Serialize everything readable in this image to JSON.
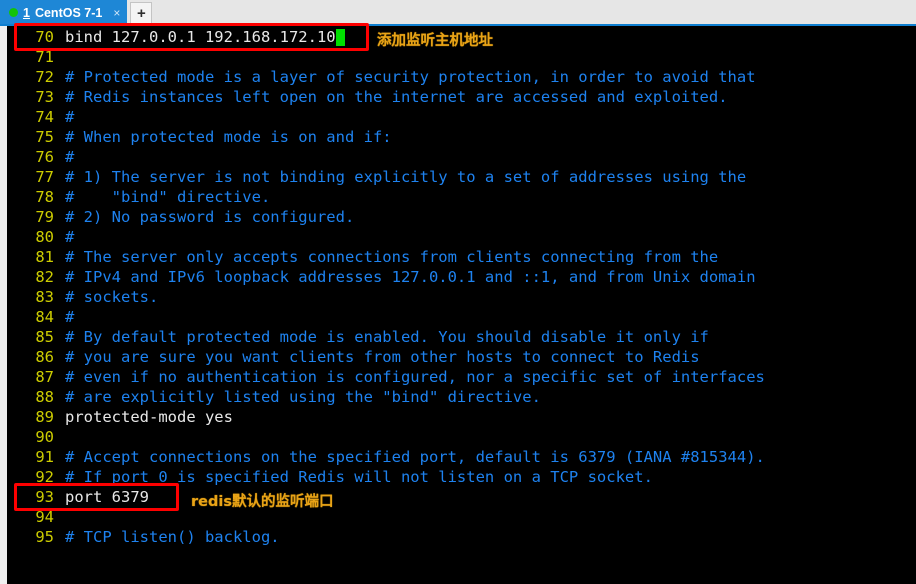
{
  "window": {
    "title": "CentOS 7-1",
    "accent_blue": "#1e87d6",
    "terminal_bg": "#000000",
    "annotation_color": "#e8a317",
    "highlight_color": "#fe0000"
  },
  "tabbar": {
    "tabs": [
      {
        "index": "1",
        "label": "CentOS 7-1",
        "status_dot": "green-dot-icon",
        "close_label": "×",
        "active": true
      }
    ],
    "new_tab_label": "+"
  },
  "terminal": {
    "app": "vim",
    "file_context": "redis.conf",
    "lines": [
      {
        "num": "70",
        "text": "bind 127.0.0.1 192.168.172.10",
        "type": "code",
        "cursor": true
      },
      {
        "num": "71",
        "text": "",
        "type": "code",
        "cursor": false
      },
      {
        "num": "72",
        "text": "# Protected mode is a layer of security protection, in order to avoid that",
        "type": "comment",
        "cursor": false
      },
      {
        "num": "73",
        "text": "# Redis instances left open on the internet are accessed and exploited.",
        "type": "comment",
        "cursor": false
      },
      {
        "num": "74",
        "text": "#",
        "type": "comment",
        "cursor": false
      },
      {
        "num": "75",
        "text": "# When protected mode is on and if:",
        "type": "comment",
        "cursor": false
      },
      {
        "num": "76",
        "text": "#",
        "type": "comment",
        "cursor": false
      },
      {
        "num": "77",
        "text": "# 1) The server is not binding explicitly to a set of addresses using the",
        "type": "comment",
        "cursor": false
      },
      {
        "num": "78",
        "text": "#    \"bind\" directive.",
        "type": "comment",
        "cursor": false
      },
      {
        "num": "79",
        "text": "# 2) No password is configured.",
        "type": "comment",
        "cursor": false
      },
      {
        "num": "80",
        "text": "#",
        "type": "comment",
        "cursor": false
      },
      {
        "num": "81",
        "text": "# The server only accepts connections from clients connecting from the",
        "type": "comment",
        "cursor": false
      },
      {
        "num": "82",
        "text": "# IPv4 and IPv6 loopback addresses 127.0.0.1 and ::1, and from Unix domain",
        "type": "comment",
        "cursor": false
      },
      {
        "num": "83",
        "text": "# sockets.",
        "type": "comment",
        "cursor": false
      },
      {
        "num": "84",
        "text": "#",
        "type": "comment",
        "cursor": false
      },
      {
        "num": "85",
        "text": "# By default protected mode is enabled. You should disable it only if",
        "type": "comment",
        "cursor": false
      },
      {
        "num": "86",
        "text": "# you are sure you want clients from other hosts to connect to Redis",
        "type": "comment",
        "cursor": false
      },
      {
        "num": "87",
        "text": "# even if no authentication is configured, nor a specific set of interfaces",
        "type": "comment",
        "cursor": false
      },
      {
        "num": "88",
        "text": "# are explicitly listed using the \"bind\" directive.",
        "type": "comment",
        "cursor": false
      },
      {
        "num": "89",
        "text": "protected-mode yes",
        "type": "code",
        "cursor": false
      },
      {
        "num": "90",
        "text": "",
        "type": "code",
        "cursor": false
      },
      {
        "num": "91",
        "text": "# Accept connections on the specified port, default is 6379 (IANA #815344).",
        "type": "comment",
        "cursor": false
      },
      {
        "num": "92",
        "text": "# If port 0 is specified Redis will not listen on a TCP socket.",
        "type": "comment",
        "cursor": false
      },
      {
        "num": "93",
        "text": "port 6379",
        "type": "code",
        "cursor": false
      },
      {
        "num": "94",
        "text": "",
        "type": "code",
        "cursor": false
      },
      {
        "num": "95",
        "text": "# TCP listen() backlog.",
        "type": "comment",
        "cursor": false
      }
    ]
  },
  "annotations": [
    {
      "id": "bind-note",
      "text": "添加监听主机地址",
      "target_line": "70"
    },
    {
      "id": "port-note",
      "text": "redis默认的监听端口",
      "target_line": "93"
    }
  ]
}
